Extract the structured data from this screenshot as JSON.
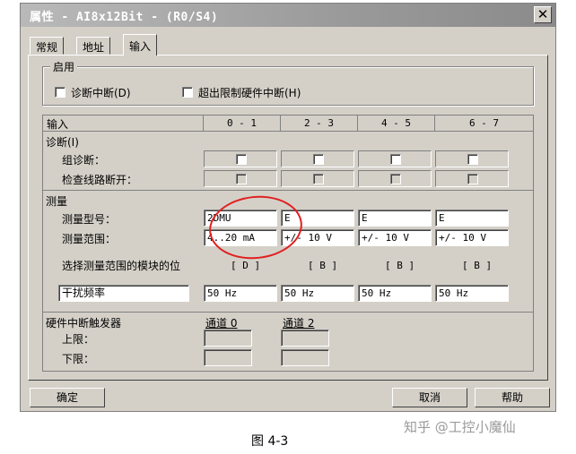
{
  "window": {
    "title": "属性 - AI8x12Bit - (R0/S4)",
    "close_glyph": "✕"
  },
  "tabs": [
    "常规",
    "地址",
    "输入"
  ],
  "enable": {
    "legend": "启用",
    "diag_interrupt": "诊断中断(D)",
    "hw_interrupt": "超出限制硬件中断(H)"
  },
  "header": {
    "label": "输入",
    "cols": [
      "0 - 1",
      "2 - 3",
      "4 - 5",
      "6 - 7"
    ]
  },
  "diagnostics": {
    "legend": "诊断(I)",
    "group_diag": "组诊断：",
    "wire_break": "检查线路断开："
  },
  "measure": {
    "legend": "测量",
    "type_label": "测量型号：",
    "range_label": "测量范围：",
    "types": [
      "2DMU",
      "E",
      "E",
      "E"
    ],
    "ranges": [
      "4..20 mA",
      "+/- 10 V",
      "+/- 10 V",
      "+/- 10 V"
    ],
    "module_pos_label": "选择测量范围的模块的位",
    "positions": [
      "[ D ]",
      "[ B ]",
      "[ B ]",
      "[ B ]"
    ],
    "interference_label": "干扰频率",
    "frequencies": [
      "50 Hz",
      "50 Hz",
      "50 Hz",
      "50 Hz"
    ]
  },
  "hw_trigger": {
    "legend": "硬件中断触发器",
    "channel0": "通道 0",
    "channel2": "通道 2",
    "upper": "上限：",
    "lower": "下限："
  },
  "buttons": {
    "ok": "确定",
    "cancel": "取消",
    "help": "帮助"
  },
  "caption": "图 4-3",
  "watermark": "知乎 @工控小魔仙"
}
